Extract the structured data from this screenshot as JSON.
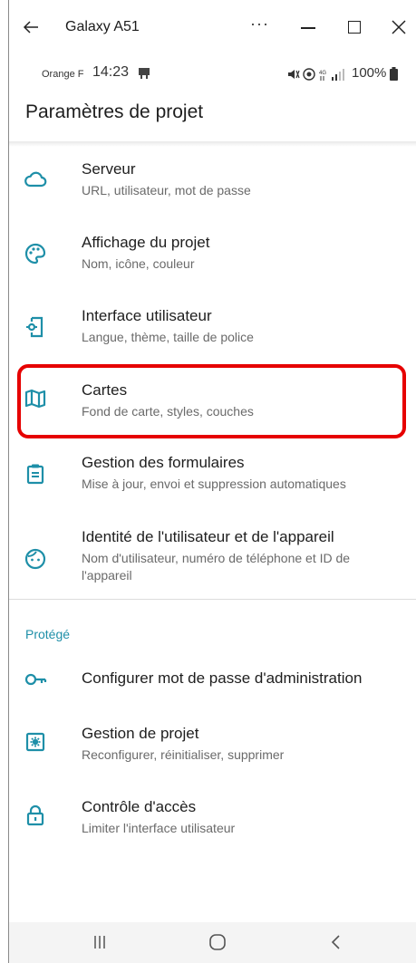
{
  "window": {
    "title": "Galaxy A51",
    "more": "···"
  },
  "status_bar": {
    "carrier": "Orange F",
    "time": "14:23",
    "battery": "100%"
  },
  "header": {
    "title": "Paramètres de projet"
  },
  "settings": [
    {
      "icon": "cloud-icon",
      "label": "Serveur",
      "sub": "URL, utilisateur, mot de passe"
    },
    {
      "icon": "palette-icon",
      "label": "Affichage du projet",
      "sub": "Nom, icône, couleur"
    },
    {
      "icon": "phone-settings-icon",
      "label": "Interface utilisateur",
      "sub": "Langue, thème, taille de police"
    },
    {
      "icon": "map-icon",
      "label": "Cartes",
      "sub": "Fond de carte, styles, couches"
    },
    {
      "icon": "clipboard-icon",
      "label": "Gestion des formulaires",
      "sub": "Mise à jour, envoi et suppression automatiques"
    },
    {
      "icon": "face-icon",
      "label": "Identité de l'utilisateur et de l'appareil",
      "sub": "Nom d'utilisateur, numéro de téléphone et ID de l'appareil"
    }
  ],
  "protected_section": {
    "title": "Protégé",
    "items": [
      {
        "icon": "key-icon",
        "label": "Configurer mot de passe d'administration"
      },
      {
        "icon": "settings-box-icon",
        "label": "Gestion de projet",
        "sub": "Reconfigurer, réinitialiser, supprimer"
      },
      {
        "icon": "lock-icon",
        "label": "Contrôle d'accès",
        "sub": "Limiter l'interface utilisateur"
      }
    ]
  },
  "colors": {
    "accent": "#1e8fa8",
    "highlight": "#e60000",
    "icon": "#1e8fa8"
  }
}
